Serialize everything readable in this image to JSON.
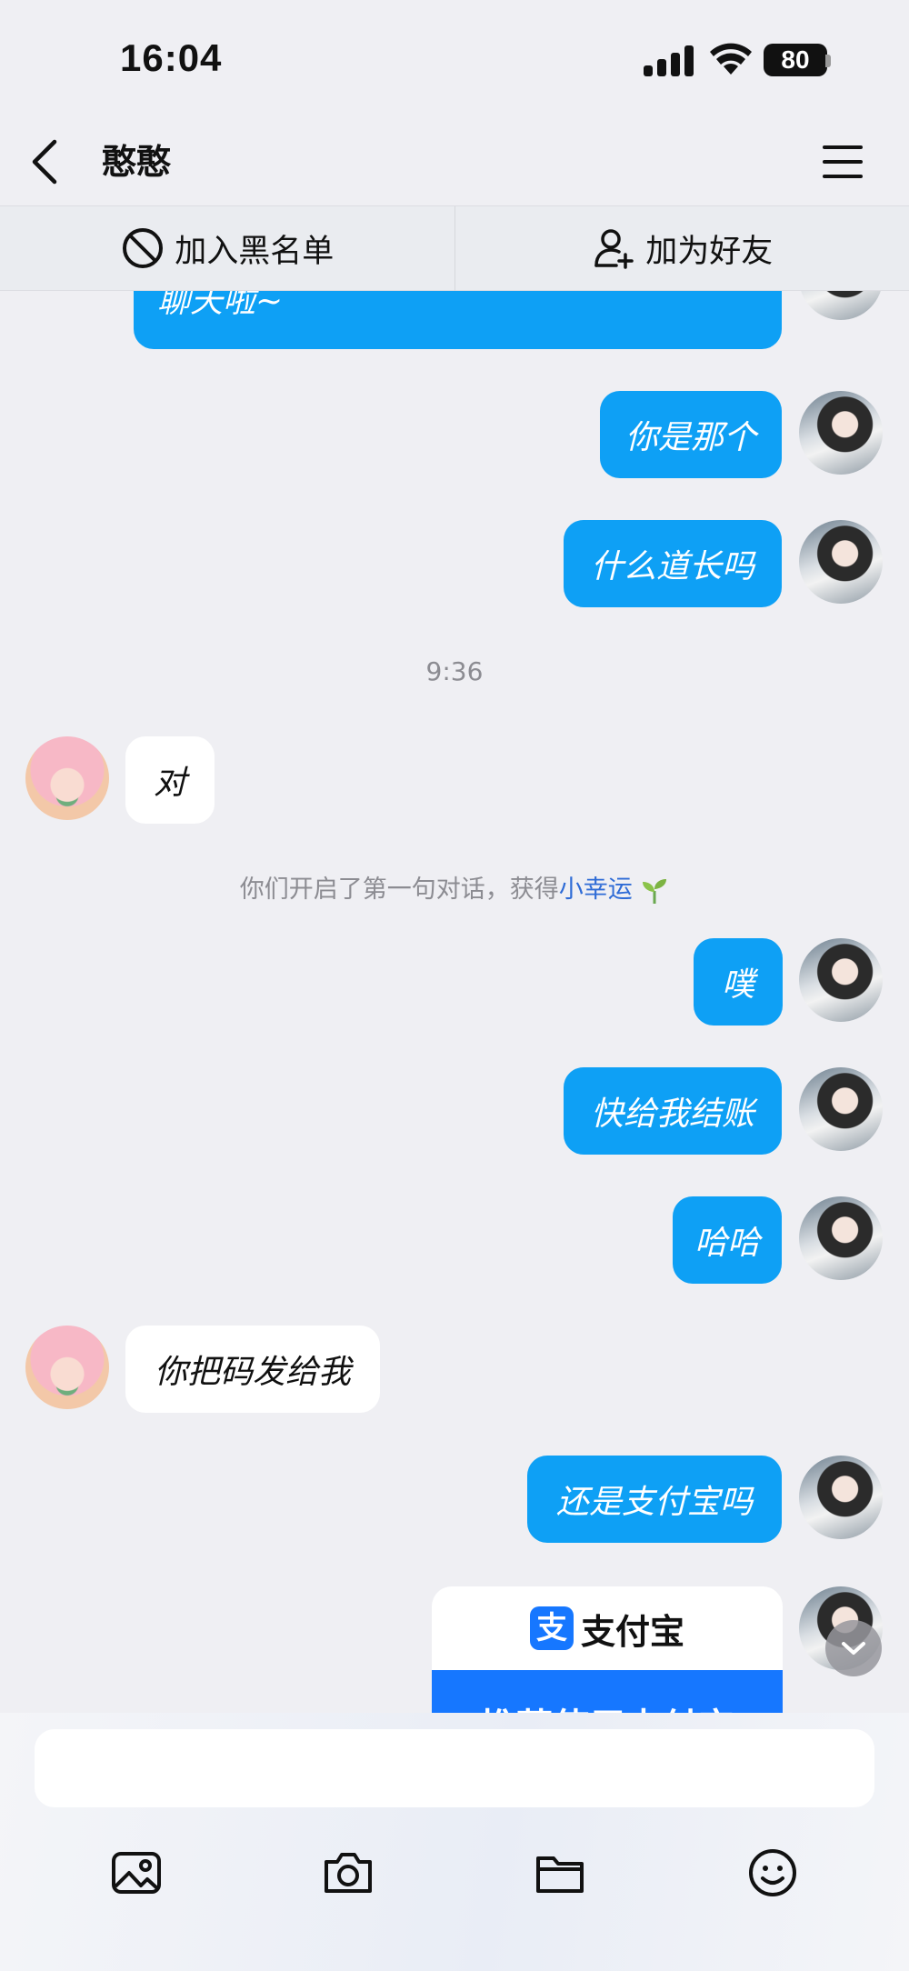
{
  "status_bar": {
    "time": "16:04",
    "battery": "80"
  },
  "nav": {
    "title": "憨憨"
  },
  "actions": {
    "blacklist": "加入黑名单",
    "add_friend": "加为好友"
  },
  "messages": [
    {
      "from": "me",
      "text": "聊天啦~"
    },
    {
      "from": "me",
      "text": "你是那个"
    },
    {
      "from": "me",
      "text": "什么道长吗"
    },
    {
      "type": "time",
      "text": "9:36"
    },
    {
      "from": "other",
      "text": "对"
    },
    {
      "type": "system",
      "text": "你们开启了第一句对话，获得",
      "link": "小幸运"
    },
    {
      "from": "me",
      "text": "噗"
    },
    {
      "from": "me",
      "text": "快给我结账"
    },
    {
      "from": "me",
      "text": "哈哈"
    },
    {
      "from": "other",
      "text": "你把码发给我"
    },
    {
      "from": "me",
      "text": "还是支付宝吗"
    }
  ],
  "card": {
    "logo": "支",
    "brand": "支付宝",
    "banner": "推荐使用支付宝"
  },
  "composer": {
    "placeholder": ""
  },
  "colors": {
    "bubble_me": "#0ea0f5",
    "bubble_other": "#ffffff",
    "background": "#efeff3",
    "link": "#2e6bd6",
    "alipay": "#1677ff"
  },
  "icons": [
    "back-icon",
    "menu-icon",
    "block-icon",
    "add-user-icon",
    "image-icon",
    "camera-icon",
    "folder-icon",
    "emoji-icon",
    "chevron-down-icon",
    "sprout-icon"
  ]
}
